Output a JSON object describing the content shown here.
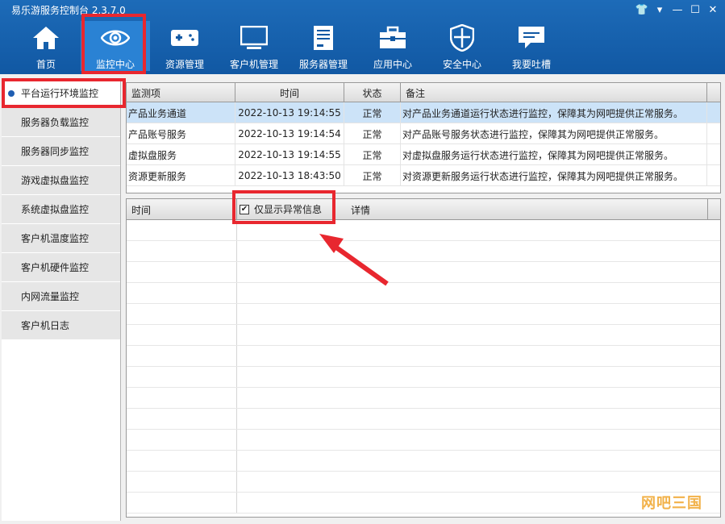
{
  "window": {
    "title": "易乐游服务控制台 2.3.7.0"
  },
  "toolbar": [
    {
      "label": "首页",
      "icon": "home-icon"
    },
    {
      "label": "监控中心",
      "icon": "eye-icon",
      "active": true
    },
    {
      "label": "资源管理",
      "icon": "gamepad-icon"
    },
    {
      "label": "客户机管理",
      "icon": "monitor-icon"
    },
    {
      "label": "服务器管理",
      "icon": "server-icon"
    },
    {
      "label": "应用中心",
      "icon": "toolbox-icon"
    },
    {
      "label": "安全中心",
      "icon": "shield-icon"
    },
    {
      "label": "我要吐槽",
      "icon": "feedback-icon"
    }
  ],
  "sidebar": [
    {
      "label": "平台运行环境监控",
      "active": true
    },
    {
      "label": "服务器负载监控"
    },
    {
      "label": "服务器同步监控"
    },
    {
      "label": "游戏虚拟盘监控"
    },
    {
      "label": "系统虚拟盘监控"
    },
    {
      "label": "客户机温度监控"
    },
    {
      "label": "客户机硬件监控"
    },
    {
      "label": "内网流量监控"
    },
    {
      "label": "客户机日志"
    }
  ],
  "monitor_table": {
    "headers": [
      "监测项",
      "时间",
      "状态",
      "备注"
    ],
    "rows": [
      [
        "产品业务通道",
        "2022-10-13 19:14:55",
        "正常",
        "对产品业务通道运行状态进行监控，保障其为网吧提供正常服务。"
      ],
      [
        "产品账号服务",
        "2022-10-13 19:14:54",
        "正常",
        "对产品账号服务状态进行监控，保障其为网吧提供正常服务。"
      ],
      [
        "虚拟盘服务",
        "2022-10-13 19:14:55",
        "正常",
        "对虚拟盘服务运行状态进行监控，保障其为网吧提供正常服务。"
      ],
      [
        "资源更新服务",
        "2022-10-13 18:43:50",
        "正常",
        "对资源更新服务运行状态进行监控，保障其为网吧提供正常服务。"
      ]
    ]
  },
  "log_table": {
    "time_header": "时间",
    "filter_label": "仅显示异常信息",
    "filter_checked": true,
    "detail_header": "详情"
  },
  "watermark": "网吧三国",
  "colors": {
    "accent": "#1d6bb8",
    "highlight": "#e8272f",
    "selected_row": "#cce3f8"
  }
}
